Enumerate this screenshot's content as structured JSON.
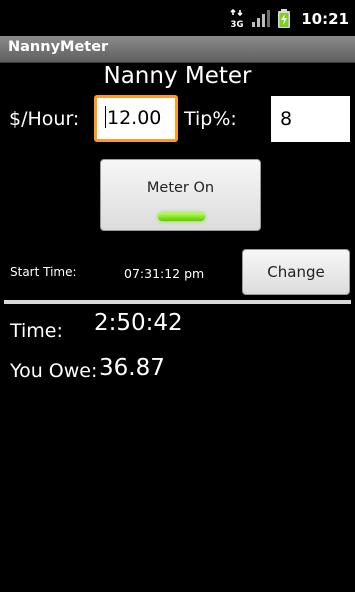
{
  "status_bar": {
    "network": "3G",
    "time": "10:21",
    "icons": [
      "3g-data-icon",
      "signal-strength-icon",
      "battery-charging-icon"
    ]
  },
  "action_bar": {
    "title": "NannyMeter"
  },
  "app": {
    "heading": "Nanny Meter",
    "rate_label": "$/Hour:",
    "rate_value": "12.00",
    "tip_label": "Tip%:",
    "tip_value": "8",
    "meter_button_label": "Meter On",
    "meter_on": true,
    "start_time_label": "Start Time:",
    "start_time_value": "07:31:12 pm",
    "change_button_label": "Change",
    "elapsed_label": "Time:",
    "elapsed_value": "2:50:42",
    "owe_label": "You Owe:",
    "owe_value": "36.87"
  },
  "colors": {
    "background": "#000000",
    "focus_border": "#ff9a22",
    "meter_indicator": "#7de61a",
    "title_bar": "#6e6e6e"
  }
}
